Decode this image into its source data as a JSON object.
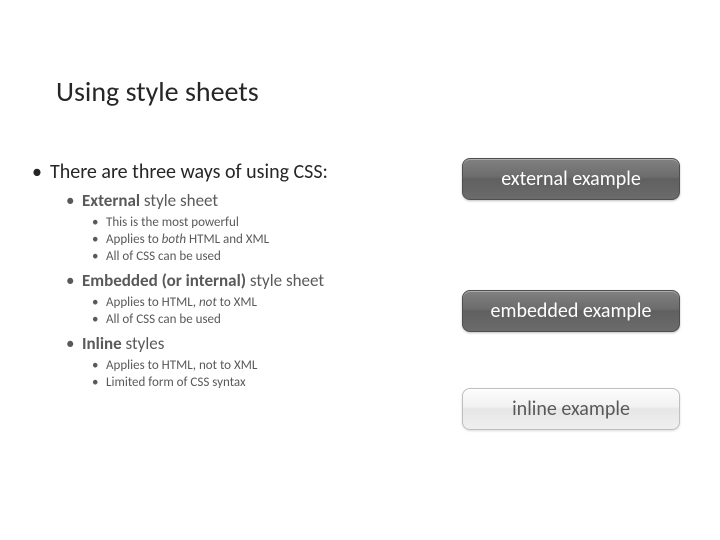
{
  "title": "Using style sheets",
  "intro": "There are three ways of using CSS:",
  "items": [
    {
      "heading_prefix": "External",
      "heading_suffix": " style sheet",
      "details": [
        {
          "text": "This is the most powerful"
        },
        {
          "text_pre": "Applies to ",
          "text_mid": "both",
          "text_post": " HTML and XML",
          "mid_italic": true
        },
        {
          "text": "All of CSS can be used"
        }
      ]
    },
    {
      "heading_prefix": "Embedded (or internal)",
      "heading_suffix": " style sheet",
      "details": [
        {
          "text_pre": "Applies to HTML, ",
          "text_mid": "not",
          "text_post": " to XML",
          "mid_italic": true
        },
        {
          "text": "All of CSS can be used"
        }
      ]
    },
    {
      "heading_prefix": "Inline",
      "heading_suffix": " styles",
      "details": [
        {
          "text": "Applies to HTML, not to XML"
        },
        {
          "text": "Limited form of CSS syntax"
        }
      ]
    }
  ],
  "buttons": {
    "external": "external example",
    "embedded": "embedded example",
    "inline": "inline example"
  }
}
